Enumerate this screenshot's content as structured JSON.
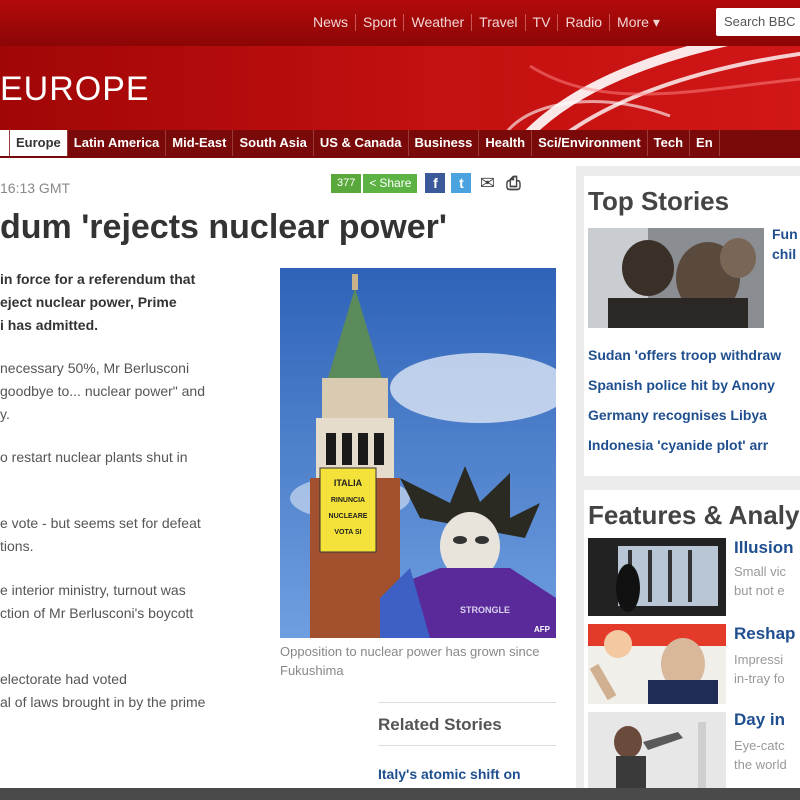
{
  "topnav": {
    "items": [
      "News",
      "Sport",
      "Weather",
      "Travel",
      "TV",
      "Radio",
      "More"
    ],
    "search_placeholder": "Search BBC"
  },
  "masthead": {
    "section": "EUROPE"
  },
  "secnav": {
    "items": [
      "Europe",
      "Latin America",
      "Mid-East",
      "South Asia",
      "US & Canada",
      "Business",
      "Health",
      "Sci/Environment",
      "Tech",
      "En"
    ],
    "active": "Europe"
  },
  "article": {
    "timestamp": "16:13 GMT",
    "share_count": "377",
    "share_label": "Share",
    "headline": "dum 'rejects nuclear power'",
    "lede": [
      "in force for a referendum that",
      "eject nuclear power, Prime",
      "i has admitted."
    ],
    "paragraphs": [
      [
        "necessary 50%, Mr Berlusconi",
        "goodbye to... nuclear power\" and",
        "y."
      ],
      [
        "o restart nuclear plants shut in"
      ],
      [
        "e vote - but seems set for defeat",
        "tions."
      ],
      [
        "e interior ministry, turnout was",
        "ction of Mr Berlusconi's boycott"
      ],
      [
        "electorate had voted",
        "al of laws brought in by the prime"
      ]
    ],
    "photo": {
      "banner_text": [
        "ITALIA",
        "RINUNCIA",
        "NUCLEARE",
        "VOTA SI"
      ],
      "credit": "AFP",
      "shirt_text": "STRONGLE"
    },
    "caption": "Opposition to nuclear power has grown since Fukushima",
    "related": {
      "title": "Related Stories",
      "links": [
        "Italy's atomic shift on"
      ]
    }
  },
  "top_stories": {
    "title": "Top Stories",
    "lead_text": [
      "Fun",
      "chil"
    ],
    "links": [
      "Sudan 'offers troop withdraw",
      "Spanish police hit by Anony",
      "Germany recognises Libya",
      "Indonesia 'cyanide plot' arr"
    ]
  },
  "features": {
    "title": "Features & Analy",
    "items": [
      {
        "title": "Illusion",
        "sub": [
          "Small vic",
          "but not e"
        ]
      },
      {
        "title": "Reshap",
        "sub": [
          "Impressi",
          "in-tray fo"
        ]
      },
      {
        "title": "Day in",
        "sub": [
          "Eye-catc",
          "the world"
        ]
      }
    ]
  }
}
